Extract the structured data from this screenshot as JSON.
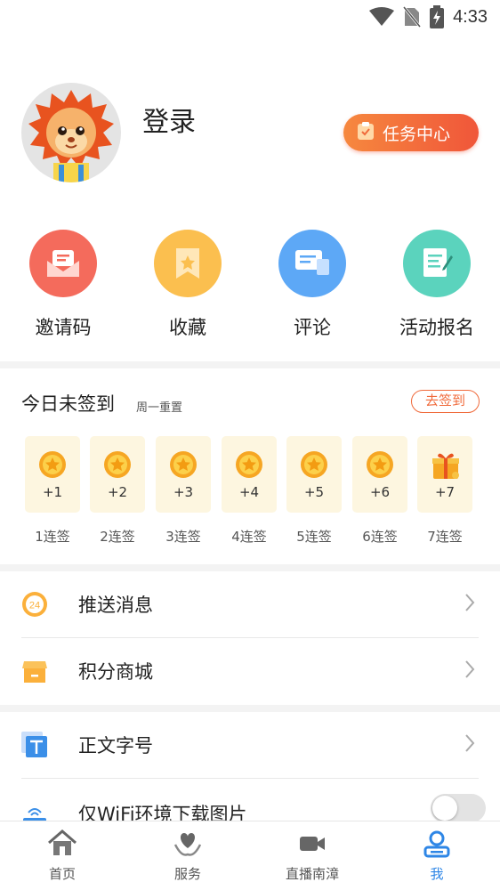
{
  "status_bar": {
    "time": "4:33"
  },
  "profile": {
    "login_label": "登录",
    "task_button_label": "任务中心"
  },
  "quick_actions": [
    {
      "label": "邀请码",
      "icon": "envelope-icon",
      "color": "#f46b5c"
    },
    {
      "label": "收藏",
      "icon": "bookmark-icon",
      "color": "#fbbf4f"
    },
    {
      "label": "评论",
      "icon": "comment-icon",
      "color": "#5da8f6"
    },
    {
      "label": "活动报名",
      "icon": "signup-form-icon",
      "color": "#5bd3bd"
    }
  ],
  "checkin": {
    "title": "今日未签到",
    "subtitle": "周一重置",
    "button_label": "去签到",
    "days": [
      {
        "points": "+1",
        "streak": "1连签",
        "icon": "coin-icon"
      },
      {
        "points": "+2",
        "streak": "2连签",
        "icon": "coin-icon"
      },
      {
        "points": "+3",
        "streak": "3连签",
        "icon": "coin-icon"
      },
      {
        "points": "+4",
        "streak": "4连签",
        "icon": "coin-icon"
      },
      {
        "points": "+5",
        "streak": "5连签",
        "icon": "coin-icon"
      },
      {
        "points": "+6",
        "streak": "6连签",
        "icon": "coin-icon"
      },
      {
        "points": "+7",
        "streak": "7连签",
        "icon": "gift-icon"
      }
    ]
  },
  "menu": {
    "push_messages": "推送消息",
    "points_mall": "积分商城",
    "font_size": "正文字号",
    "wifi_only_images": "仅WiFi环境下载图片",
    "push_badge": "24"
  },
  "bottom_nav": [
    {
      "label": "首页",
      "icon": "home-icon",
      "active": false
    },
    {
      "label": "服务",
      "icon": "heart-hands-icon",
      "active": false
    },
    {
      "label": "直播南漳",
      "icon": "video-camera-icon",
      "active": false
    },
    {
      "label": "我",
      "icon": "user-icon",
      "active": true
    }
  ],
  "colors": {
    "accent": "#f06a3b",
    "nav_active": "#2e86e6",
    "checkin_card": "#fdf6e0"
  }
}
